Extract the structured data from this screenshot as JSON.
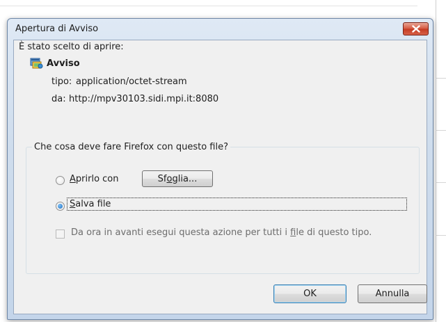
{
  "dialog": {
    "title": "Apertura di Avviso",
    "intro": "È stato scelto di aprire:",
    "file": {
      "name": "Avviso",
      "type_label": "tipo:",
      "type_value": "application/octet-stream",
      "from_label": "da:",
      "from_value": "http://mpv30103.sidi.mpi.it:8080"
    },
    "action_group": {
      "legend": "Che cosa deve fare Firefox con questo file?",
      "open_with": {
        "accel": "A",
        "rest": "prirlo con",
        "selected": false
      },
      "browse_button": {
        "pre": "Sf",
        "accel": "o",
        "post": "glia..."
      },
      "save_file": {
        "accel": "S",
        "rest": "alva file",
        "selected": true
      },
      "remember": {
        "pre": "Da ora in avanti esegui questa azione per tutti i ",
        "accel": "f",
        "post": "ile di questo tipo.",
        "checked": false,
        "enabled": false
      }
    },
    "buttons": {
      "ok": "OK",
      "cancel": "Annulla"
    }
  },
  "colors": {
    "title_bar": "#cfdded",
    "close_button": "#c9452d",
    "client_background": "#f0f0f0",
    "radio_selected": "#1d6fc2"
  },
  "icons": {
    "file_icon": "application-icon",
    "close_icon": "close-icon"
  }
}
